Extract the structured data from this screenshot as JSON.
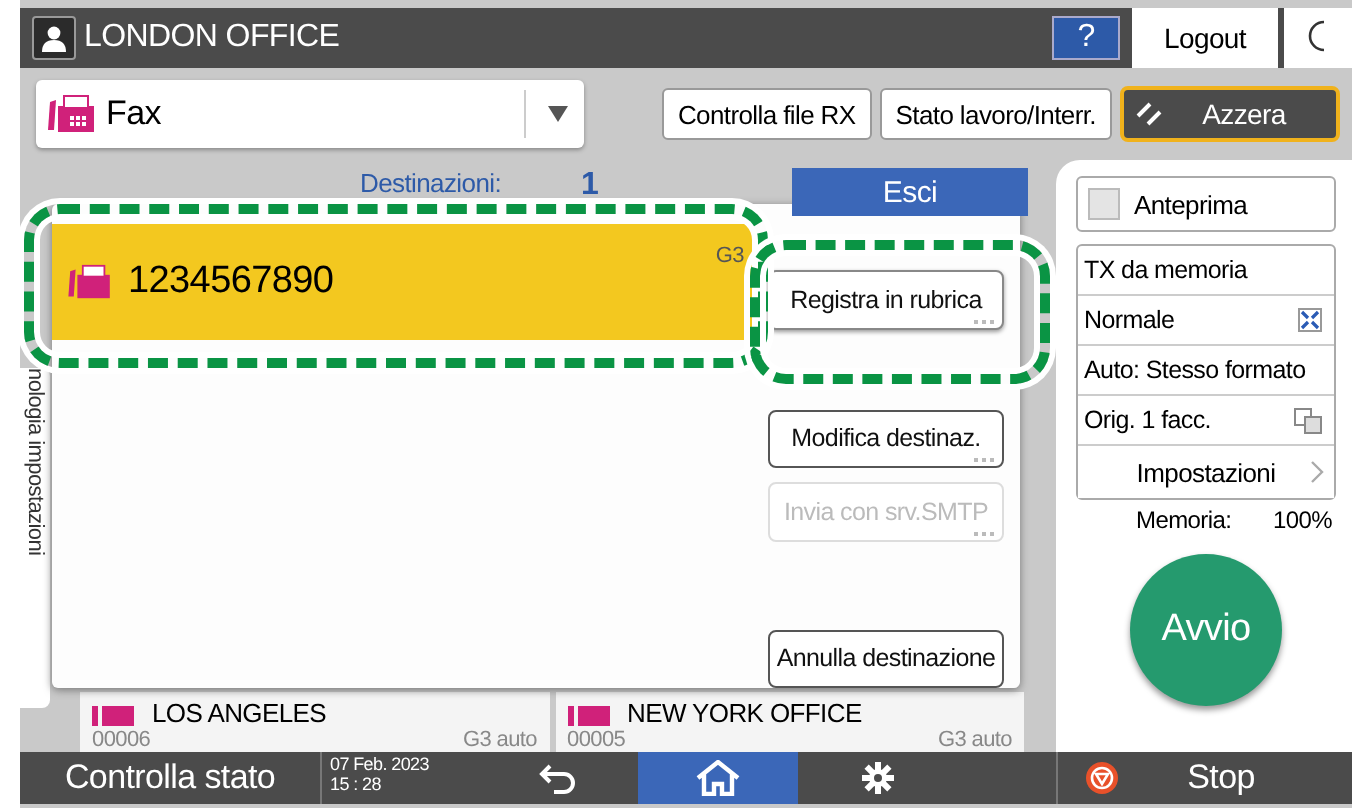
{
  "header": {
    "title": "LONDON OFFICE",
    "help": "?",
    "logout": "Logout"
  },
  "mode_select": {
    "value": "Fax"
  },
  "top_buttons": [
    "Controlla file RX",
    "Stato lavoro/Interr."
  ],
  "reset_button": "Azzera",
  "side_tab": "nologia impostazioni",
  "destinations_header": {
    "label": "Destinazioni:",
    "count": "1"
  },
  "exit_button": "Esci",
  "background_entries": [
    {
      "name": "LOS ANGELES",
      "number": "00006",
      "mode": "G3 auto"
    },
    {
      "name": "NEW YORK OFFICE",
      "number": "00005",
      "mode": "G3 auto"
    }
  ],
  "dialog": {
    "entry": {
      "number": "1234567890",
      "line": "G3",
      "selected": true,
      "highlighted": true
    },
    "actions": [
      {
        "label": "Registra in rubrica",
        "disabled": false,
        "more": true,
        "highlighted": true
      },
      {
        "label": "Modifica destinaz.",
        "disabled": false,
        "more": true,
        "highlighted": false
      },
      {
        "label": "Invia con srv.SMTP",
        "disabled": true,
        "more": true,
        "highlighted": false
      },
      {
        "label": "Annulla destinazione",
        "disabled": false,
        "more": false,
        "highlighted": false
      }
    ]
  },
  "right_panel": {
    "preview": {
      "label": "Anteprima",
      "checked": false
    },
    "settings": [
      {
        "label": "TX da memoria",
        "kind": "text"
      },
      {
        "label": "Normale",
        "kind": "resolution"
      },
      {
        "label": "Auto: Stesso formato",
        "kind": "text"
      },
      {
        "label": "Orig. 1 facc.",
        "kind": "original"
      }
    ],
    "settings_button": "Impostazioni",
    "memory_label": "Memoria:",
    "memory_value": "100%",
    "start_button": "Avvio"
  },
  "status_bar": {
    "status_button": "Controlla stato",
    "date": "07 Feb. 2023",
    "time": "15 : 28",
    "home_selected": true,
    "stop_button": "Stop"
  }
}
